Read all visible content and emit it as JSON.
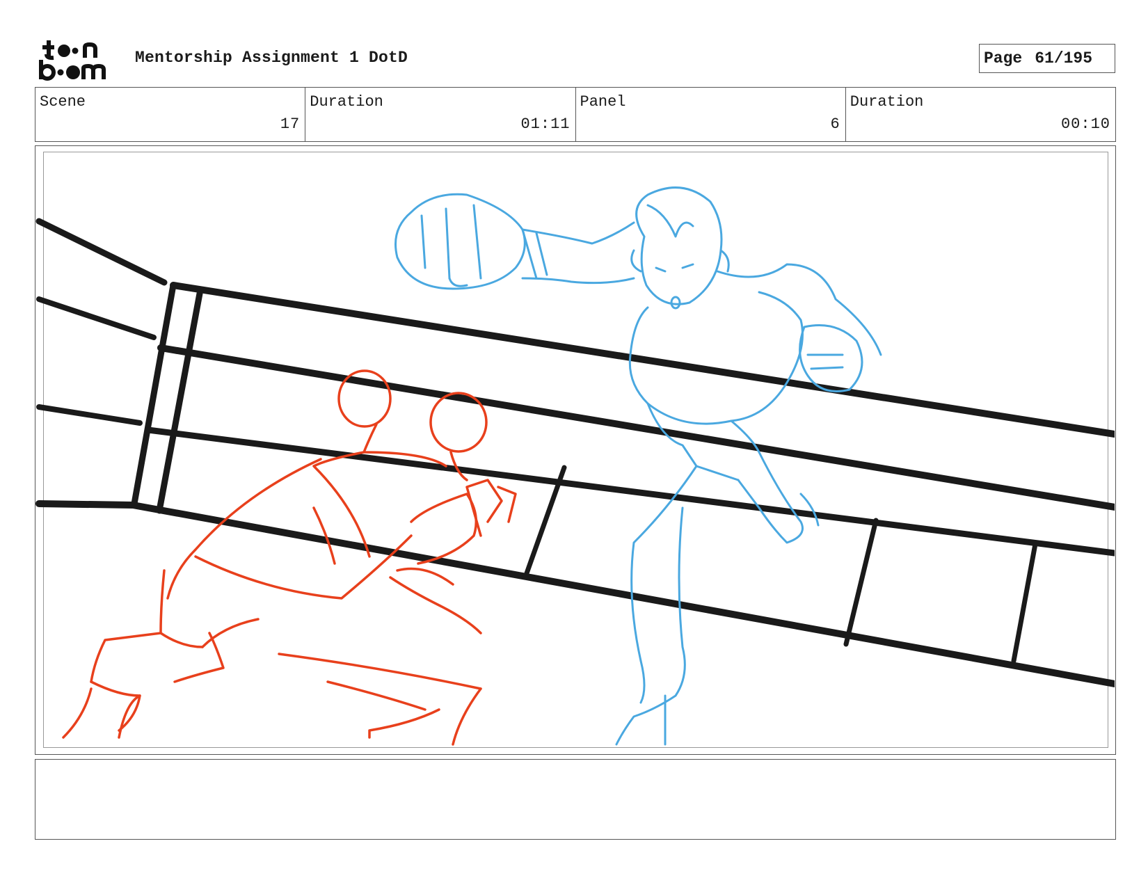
{
  "header": {
    "logo_text": "toon boom",
    "title": "Mentorship Assignment 1 DotD",
    "page_label": "Page",
    "page_value": "61/195"
  },
  "info": {
    "scene_label": "Scene",
    "scene_value": "17",
    "scene_duration_label": "Duration",
    "scene_duration_value": "01:11",
    "panel_label": "Panel",
    "panel_value": "6",
    "panel_duration_label": "Duration",
    "panel_duration_value": "00:10"
  },
  "panel": {
    "colors": {
      "ring_ropes": "#1a1a1a",
      "red_character": "#e8401c",
      "blue_character": "#4aa8e0"
    }
  },
  "notes": {
    "text": ""
  }
}
